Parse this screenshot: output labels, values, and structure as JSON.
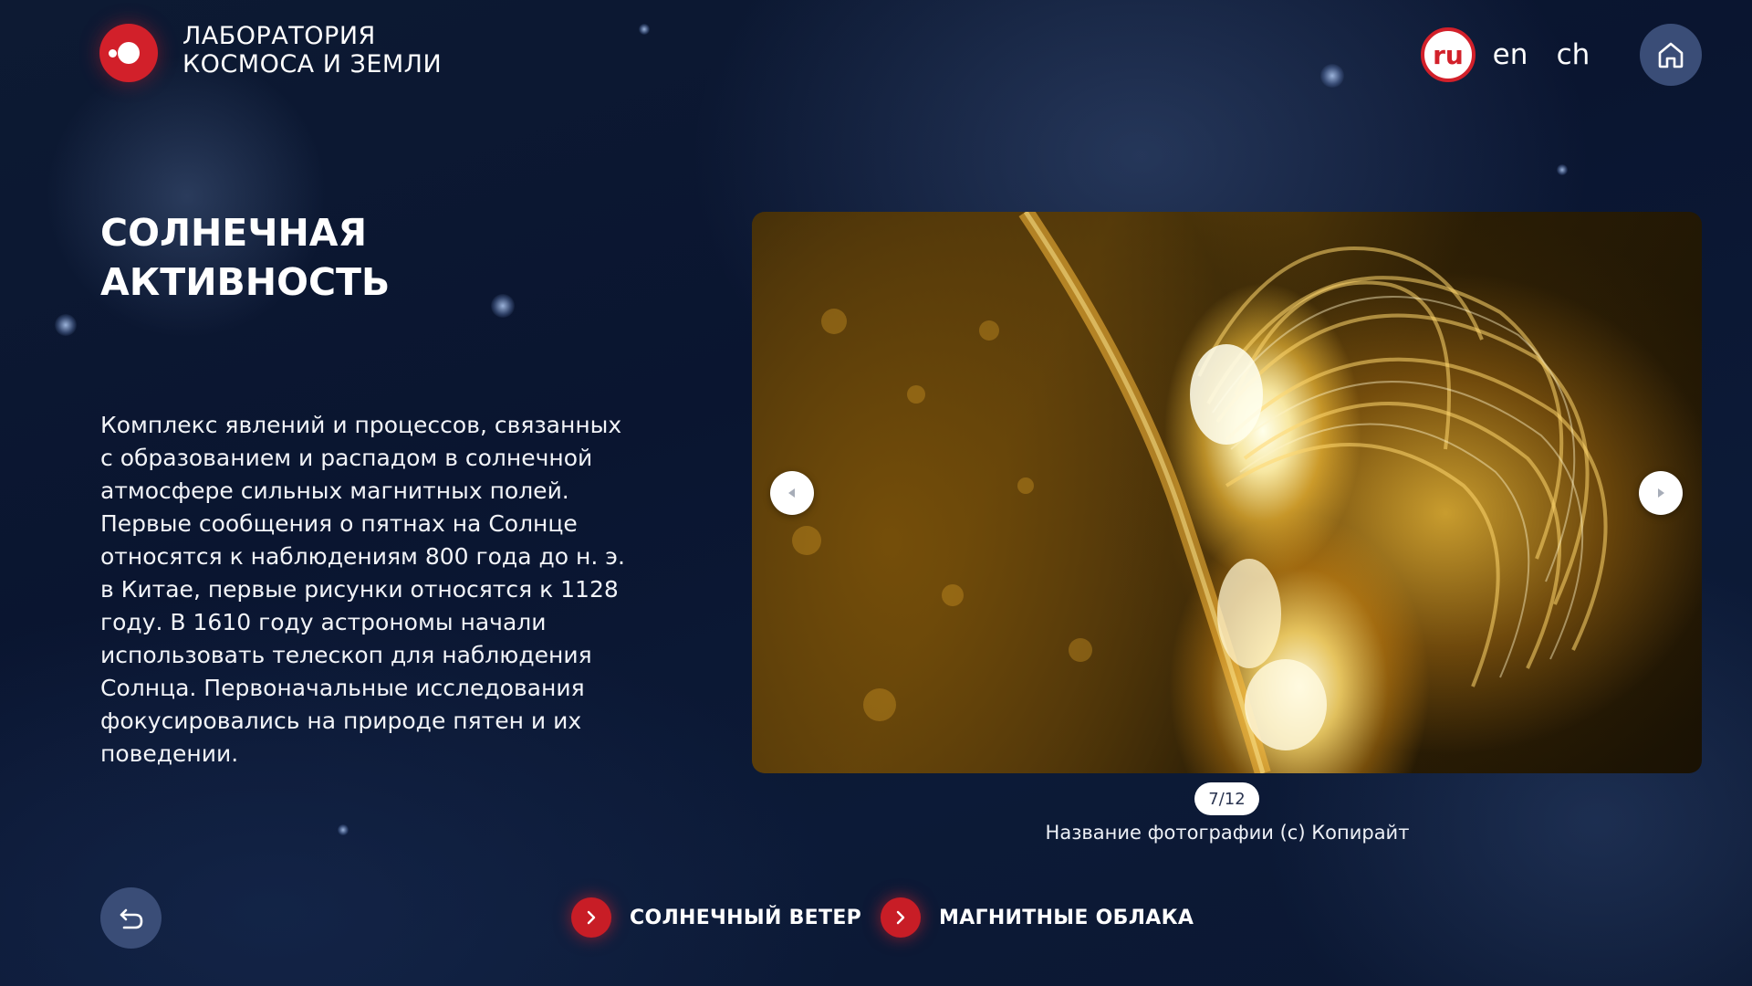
{
  "header": {
    "logo_icon": "circle-dot-logo-icon",
    "logo_line1": "ЛАБОРАТОРИЯ",
    "logo_line2": "КОСМОСА И ЗЕМЛИ",
    "languages": [
      {
        "code": "ru",
        "active": true
      },
      {
        "code": "en",
        "active": false
      },
      {
        "code": "ch",
        "active": false
      }
    ],
    "home_icon": "home-icon"
  },
  "main": {
    "title_line1": "СОЛНЕЧНАЯ",
    "title_line2": "АКТИВНОСТЬ",
    "description": "Комплекс явлений и процессов, связанных с образованием и распадом в солнечной атмосфере сильных магнитных полей. Первые сообщения о пятнах на Солнце относятся к наблюдениям 800 года до н. э. в Китае, первые рисунки относятся к 1128 году. В 1610 году астрономы начали использовать телескоп для наблюдения Солнца. Первоначальные исследования фокусировались на природе пятен и их поведении."
  },
  "gallery": {
    "current": 7,
    "total": 12,
    "counter_text": "7/12",
    "caption": "Название фотографии (с) Копирайт",
    "prev_icon": "chevron-left-icon",
    "next_icon": "chevron-right-icon"
  },
  "footer": {
    "back_icon": "back-arrow-icon",
    "related": [
      {
        "label": "СОЛНЕЧНЫЙ ВЕТЕР",
        "icon": "chevron-right-icon"
      },
      {
        "label": "МАГНИТНЫЕ ОБЛАКА",
        "icon": "chevron-right-icon"
      }
    ]
  },
  "colors": {
    "accent": "#d2202a",
    "background": "#0c1a37",
    "button_bg": "#3a4d77"
  }
}
